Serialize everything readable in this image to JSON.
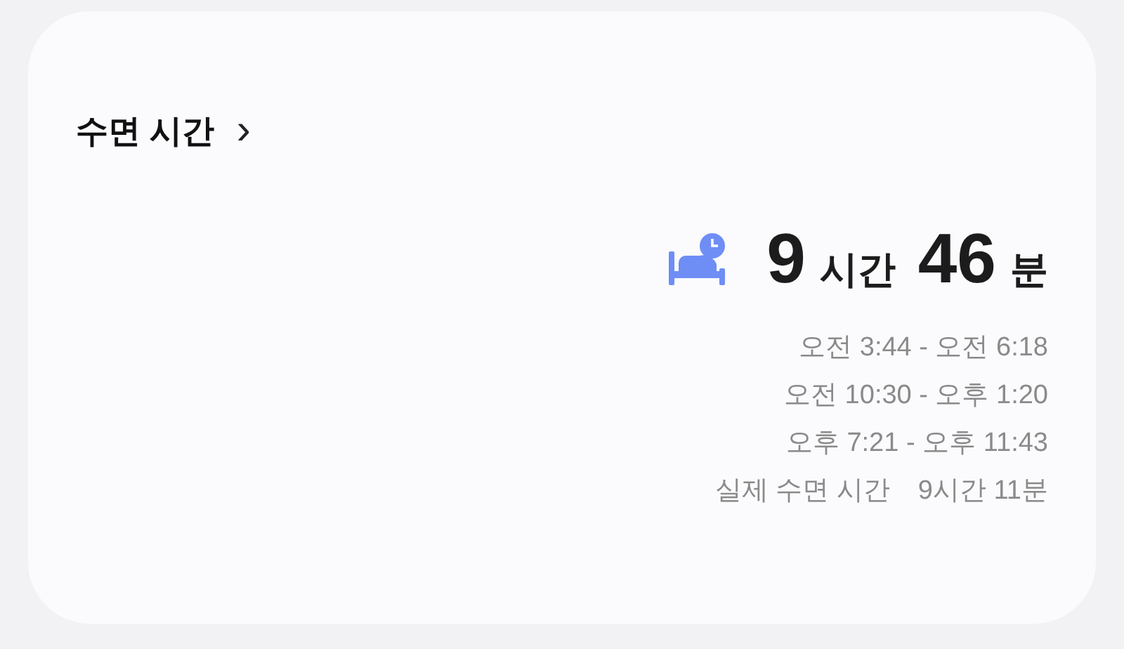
{
  "card": {
    "title": "수면 시간",
    "chevron": "›",
    "total": {
      "hours": "9",
      "hours_unit": "시간",
      "minutes": "46",
      "minutes_unit": "분"
    },
    "sessions": [
      {
        "text": "오전 3:44 - 오전 6:18"
      },
      {
        "text": "오전 10:30 - 오후 1:20"
      },
      {
        "text": "오후 7:21 - 오후 11:43"
      }
    ],
    "actual": {
      "label": "실제 수면 시간",
      "value": "9시간 11분"
    }
  }
}
